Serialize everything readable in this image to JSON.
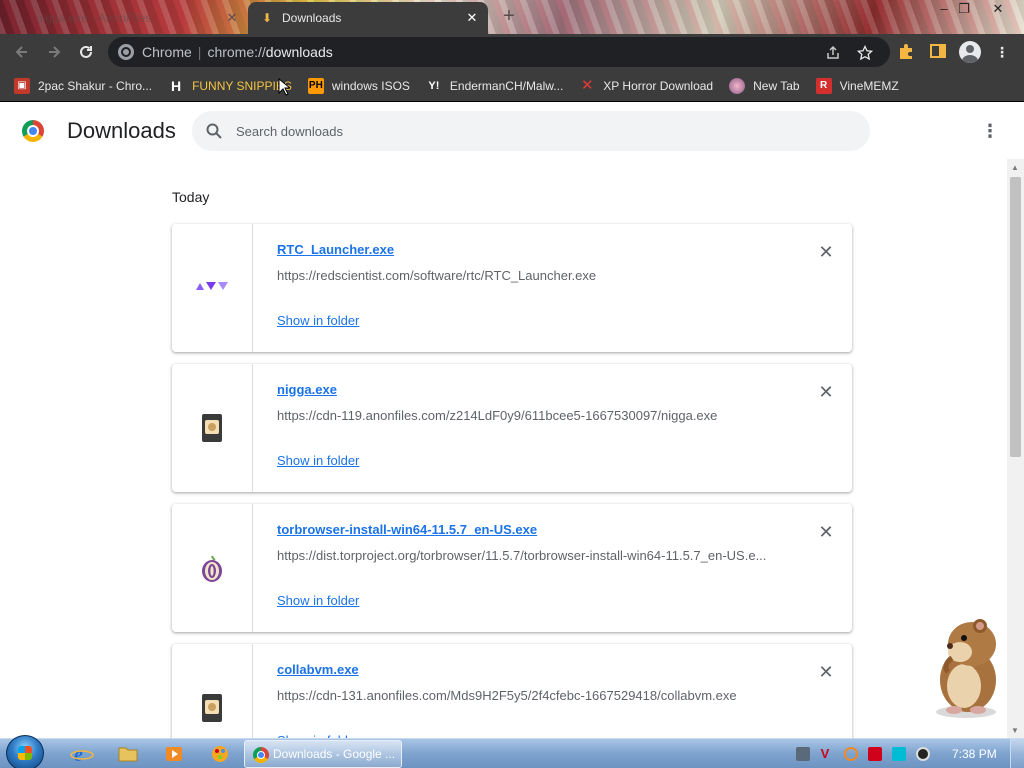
{
  "window": {
    "tabs": [
      {
        "title": "nigga.exe - AnonFiles",
        "active": false
      },
      {
        "title": "Downloads",
        "active": true
      }
    ],
    "controls": {
      "minimize": "–",
      "maximize": "❐",
      "close": "✕"
    }
  },
  "toolbar": {
    "omnibox": {
      "scheme_label": "Chrome",
      "url_prefix": "chrome://",
      "url_host": "downloads"
    }
  },
  "bookmarks": [
    {
      "label": "2pac Shakur - Chro...",
      "icon": "bookmark-favicon-2pac",
      "color": "#c0392b"
    },
    {
      "label": "FUNNY SNIPPIES",
      "icon": "h-icon",
      "color": "#ffffff"
    },
    {
      "label": "windows ISOS",
      "icon": "ph-icon",
      "color": "#ff9900"
    },
    {
      "label": "EndermanCH/Malw...",
      "icon": "yp-icon",
      "color": "#ffffff"
    },
    {
      "label": "XP Horror Download",
      "icon": "x-icon",
      "color": "#e53935"
    },
    {
      "label": "New Tab",
      "icon": "globe-icon",
      "color": "#e8a0c0"
    },
    {
      "label": "VineMEMZ",
      "icon": "r-icon",
      "color": "#d32f2f"
    }
  ],
  "page": {
    "title": "Downloads",
    "search": {
      "placeholder": "Search downloads",
      "value": ""
    },
    "date_heading": "Today",
    "downloads": [
      {
        "name": "RTC_Launcher.exe",
        "url": "https://redscientist.com/software/rtc/RTC_Launcher.exe",
        "action": "Show in folder",
        "icon": "rtc-launcher-icon"
      },
      {
        "name": "nigga.exe",
        "url": "https://cdn-119.anonfiles.com/z214LdF0y9/611bcee5-1667530097/nigga.exe",
        "action": "Show in folder",
        "icon": "executable-file-icon"
      },
      {
        "name": "torbrowser-install-win64-11.5.7_en-US.exe",
        "url": "https://dist.torproject.org/torbrowser/11.5.7/torbrowser-install-win64-11.5.7_en-US.e...",
        "action": "Show in folder",
        "icon": "tor-onion-icon"
      },
      {
        "name": "collabvm.exe",
        "url": "https://cdn-131.anonfiles.com/Mds9H2F5y5/2f4cfebc-1667529418/collabvm.exe",
        "action": "Show in folder",
        "icon": "executable-file-icon"
      }
    ]
  },
  "taskbar": {
    "active_task": "Downloads - Google ...",
    "clock": "7:38 PM"
  },
  "colors": {
    "link": "#1a73e8",
    "toolbar_bg": "#3c3c3c",
    "page_bg": "#ffffff"
  }
}
